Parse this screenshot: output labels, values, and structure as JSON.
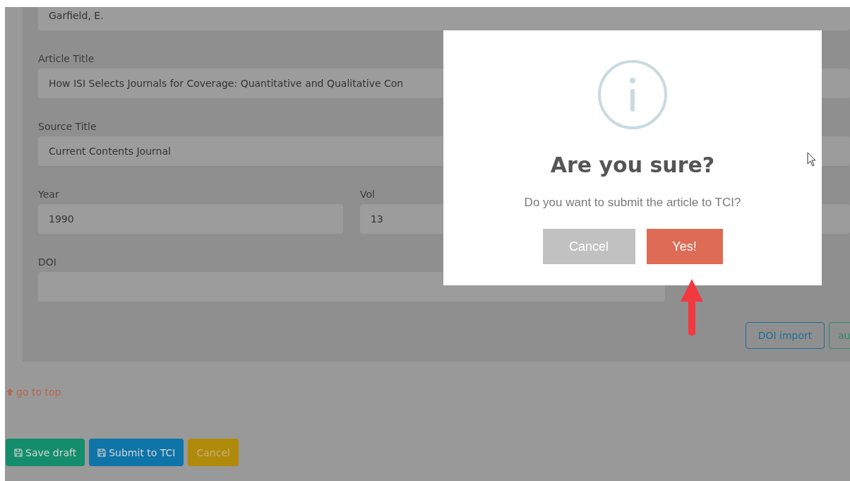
{
  "form": {
    "fields": [
      {
        "value": "Garfield, E."
      },
      {
        "label": "Article Title",
        "value": "How ISI Selects Journals for Coverage: Quantitative and Qualitative Con"
      },
      {
        "label": "Source Title",
        "value": "Current Contents Journal"
      }
    ],
    "pair": [
      {
        "label": "Year",
        "value": "1990"
      },
      {
        "label": "Vol",
        "value": "13"
      }
    ],
    "doi": {
      "label": "DOI"
    },
    "import_buttons": [
      {
        "kind": "primary",
        "label": "DOI import"
      },
      {
        "kind": "success",
        "label": "au"
      }
    ]
  },
  "go_to_top": "go to top",
  "actions": [
    {
      "kind": "save",
      "label": "Save draft"
    },
    {
      "kind": "submit",
      "label": "Submit to TCI"
    },
    {
      "kind": "cancel",
      "label": "Cancel"
    }
  ],
  "dialog": {
    "title": "Are you sure?",
    "message": "Do you want to submit the article to TCI?",
    "buttons": [
      {
        "kind": "cancel",
        "label": "Cancel"
      },
      {
        "kind": "confirm",
        "label": "Yes!"
      }
    ]
  }
}
